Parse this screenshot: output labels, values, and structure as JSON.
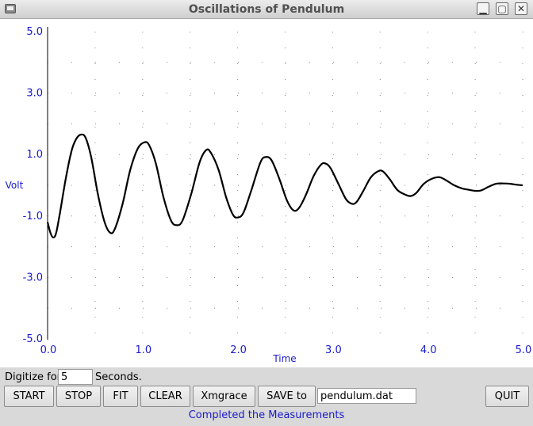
{
  "window": {
    "title": "Oscillations of Pendulum",
    "minimize_label": "▁",
    "maximize_label": "▢",
    "close_label": "✕"
  },
  "chart_data": {
    "type": "line",
    "xlabel": "Time",
    "ylabel": "Volt",
    "xlim": [
      0,
      5
    ],
    "ylim": [
      -5,
      5
    ],
    "x_ticks": [
      "0.0",
      "1.0",
      "2.0",
      "3.0",
      "4.0",
      "5.0"
    ],
    "y_ticks": [
      "5.0",
      "3.0",
      "1.0",
      "-1.0",
      "-3.0",
      "-5.0"
    ],
    "grid": "dotted",
    "series": [
      {
        "color": "#000000",
        "points": [
          [
            0.0,
            -1.2
          ],
          [
            0.03,
            -1.55
          ],
          [
            0.06,
            -1.7
          ],
          [
            0.09,
            -1.55
          ],
          [
            0.13,
            -0.9
          ],
          [
            0.19,
            0.2
          ],
          [
            0.25,
            1.1
          ],
          [
            0.3,
            1.5
          ],
          [
            0.35,
            1.65
          ],
          [
            0.4,
            1.55
          ],
          [
            0.46,
            0.9
          ],
          [
            0.53,
            -0.3
          ],
          [
            0.6,
            -1.2
          ],
          [
            0.66,
            -1.55
          ],
          [
            0.71,
            -1.4
          ],
          [
            0.79,
            -0.6
          ],
          [
            0.87,
            0.5
          ],
          [
            0.95,
            1.2
          ],
          [
            1.02,
            1.4
          ],
          [
            1.07,
            1.3
          ],
          [
            1.14,
            0.7
          ],
          [
            1.22,
            -0.4
          ],
          [
            1.3,
            -1.15
          ],
          [
            1.36,
            -1.3
          ],
          [
            1.42,
            -1.15
          ],
          [
            1.51,
            -0.3
          ],
          [
            1.6,
            0.75
          ],
          [
            1.67,
            1.15
          ],
          [
            1.72,
            1.05
          ],
          [
            1.8,
            0.5
          ],
          [
            1.88,
            -0.4
          ],
          [
            1.95,
            -0.95
          ],
          [
            2.0,
            -1.05
          ],
          [
            2.06,
            -0.9
          ],
          [
            2.14,
            -0.2
          ],
          [
            2.24,
            0.75
          ],
          [
            2.3,
            0.92
          ],
          [
            2.36,
            0.8
          ],
          [
            2.44,
            0.2
          ],
          [
            2.52,
            -0.5
          ],
          [
            2.59,
            -0.82
          ],
          [
            2.65,
            -0.72
          ],
          [
            2.72,
            -0.3
          ],
          [
            2.8,
            0.3
          ],
          [
            2.88,
            0.68
          ],
          [
            2.93,
            0.7
          ],
          [
            2.98,
            0.55
          ],
          [
            3.06,
            0.05
          ],
          [
            3.14,
            -0.45
          ],
          [
            3.2,
            -0.6
          ],
          [
            3.25,
            -0.55
          ],
          [
            3.32,
            -0.2
          ],
          [
            3.4,
            0.25
          ],
          [
            3.48,
            0.46
          ],
          [
            3.53,
            0.45
          ],
          [
            3.6,
            0.2
          ],
          [
            3.68,
            -0.15
          ],
          [
            3.76,
            -0.3
          ],
          [
            3.82,
            -0.35
          ],
          [
            3.88,
            -0.25
          ],
          [
            3.96,
            0.05
          ],
          [
            4.05,
            0.22
          ],
          [
            4.13,
            0.26
          ],
          [
            4.2,
            0.15
          ],
          [
            4.28,
            0.0
          ],
          [
            4.36,
            -0.1
          ],
          [
            4.44,
            -0.15
          ],
          [
            4.5,
            -0.18
          ],
          [
            4.56,
            -0.17
          ],
          [
            4.64,
            -0.05
          ],
          [
            4.72,
            0.05
          ],
          [
            4.8,
            0.06
          ],
          [
            4.87,
            0.05
          ],
          [
            4.93,
            0.02
          ],
          [
            5.0,
            0.0
          ]
        ]
      }
    ]
  },
  "controls": {
    "digitize_label": "Digitize for",
    "seconds_value": "5",
    "seconds_label": "Seconds.",
    "start_label": "START",
    "stop_label": "STOP",
    "fit_label": "FIT",
    "clear_label": "CLEAR",
    "xmgrace_label": "Xmgrace",
    "save_label": "SAVE to",
    "filename_value": "pendulum.dat",
    "quit_label": "QUIT"
  },
  "status": {
    "message": "Completed the Measurements",
    "color": "#1a1acc"
  },
  "colors": {
    "axis_label": "#1a1acc",
    "plot_bg": "#ffffff",
    "grid": "#888888"
  }
}
